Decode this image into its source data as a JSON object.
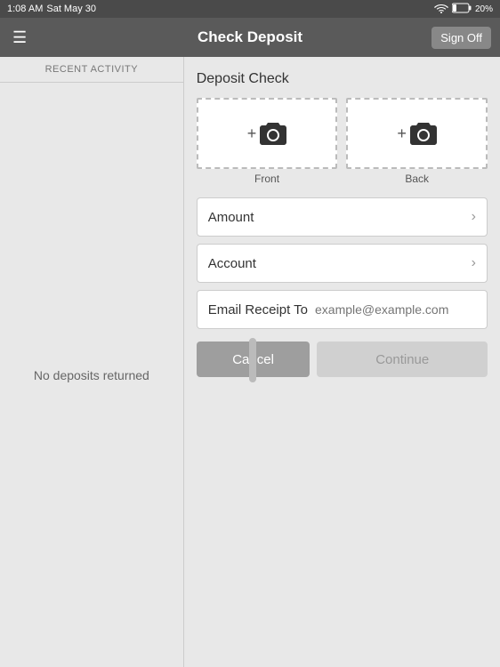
{
  "status_bar": {
    "time": "1:08 AM",
    "date": "Sat May 30",
    "battery_pct": "20%"
  },
  "nav": {
    "title": "Check Deposit",
    "sign_on_label": "Sign Off"
  },
  "left_panel": {
    "recent_activity_header": "RECENT ACTIVITY",
    "no_deposits_text": "No deposits returned"
  },
  "right_panel": {
    "deposit_check_title": "Deposit Check",
    "front_label": "Front",
    "back_label": "Back",
    "amount_label": "Amount",
    "account_label": "Account",
    "email_receipt_label": "Email Receipt To",
    "email_placeholder": "example@example.com",
    "cancel_label": "Cancel",
    "continue_label": "Continue"
  }
}
